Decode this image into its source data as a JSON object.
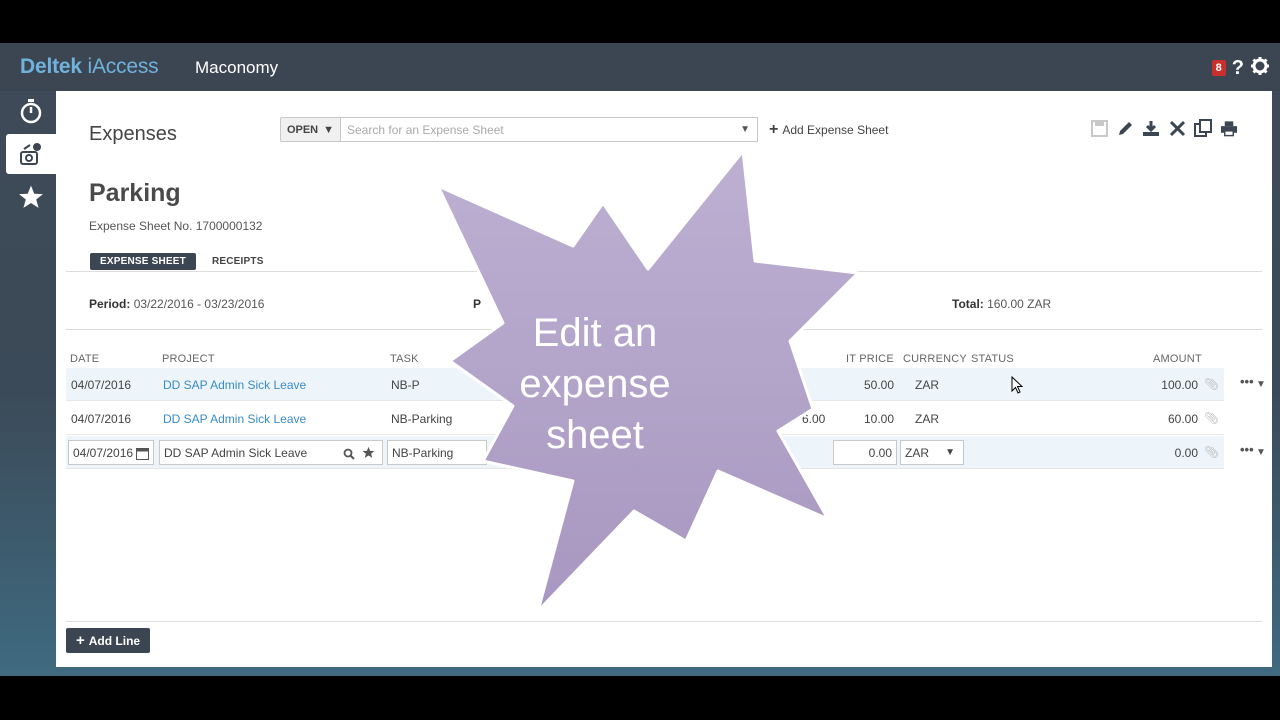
{
  "topbar": {
    "brand_bold": "Deltek",
    "brand_light": " iAccess",
    "app_name": "Maconomy",
    "notification_count": "8",
    "help_icon": "?"
  },
  "section": {
    "title": "Expenses",
    "open_label": "OPEN",
    "search_placeholder": "Search for an Expense Sheet",
    "add_sheet_label": "Add Expense Sheet"
  },
  "sheet": {
    "title": "Parking",
    "number": "Expense Sheet No. 1700000132",
    "tabs": [
      "EXPENSE SHEET",
      "RECEIPTS"
    ],
    "period_label": "Period:",
    "period_value": "03/22/2016 - 03/23/2016",
    "partial_label": "P",
    "total_label": "Total:",
    "total_value": "160.00 ZAR"
  },
  "columns": [
    "DATE",
    "PROJECT",
    "TASK",
    "IT PRICE",
    "CURRENCY",
    "STATUS",
    "AMOUNT"
  ],
  "rows": [
    {
      "date": "04/07/2016",
      "project": "DD SAP Admin Sick Leave",
      "task": "NB-P",
      "qty": "",
      "price": "50.00",
      "currency": "ZAR",
      "amount": "100.00"
    },
    {
      "date": "04/07/2016",
      "project": "DD SAP Admin Sick Leave",
      "task": "NB-Parking",
      "qty": "6.00",
      "price": "10.00",
      "currency": "ZAR",
      "amount": "60.00"
    }
  ],
  "edit_row": {
    "date": "04/07/2016",
    "project": "DD SAP Admin Sick Leave",
    "task": "NB-Parking",
    "price": "0.00",
    "currency": "ZAR",
    "amount": "0.00"
  },
  "add_line_label": "Add Line",
  "overlay": {
    "line1": "Edit an",
    "line2": "expense",
    "line3": "sheet"
  },
  "colors": {
    "topbar": "#3c4652",
    "brand": "#6fb2dc",
    "link": "#3a8bc4",
    "starburst": "#b5a6cb"
  }
}
